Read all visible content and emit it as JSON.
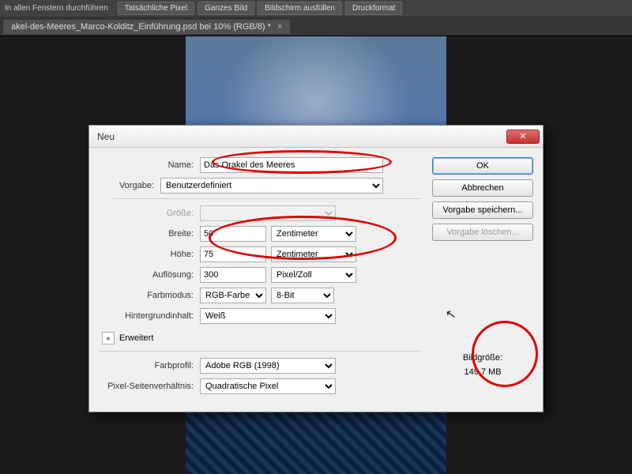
{
  "toolbar": {
    "label": "In allen Fenstern durchführen",
    "buttons": [
      "Tatsächliche Pixel",
      "Ganzes Bild",
      "Bildschirm ausfüllen",
      "Druckformat"
    ]
  },
  "doc_tab": {
    "title": "akel-des-Meeres_Marco-Kolditz_Einführung.psd bei 10% (RGB/8) *",
    "close": "×"
  },
  "dialog": {
    "title": "Neu",
    "labels": {
      "name": "Name:",
      "vorgabe": "Vorgabe:",
      "groesse": "Größe:",
      "breite": "Breite:",
      "hoehe": "Höhe:",
      "aufloesung": "Auflösung:",
      "farbmodus": "Farbmodus:",
      "hintergrund": "Hintergrundinhalt:",
      "erweitert": "Erweitert",
      "farbprofil": "Farbprofil:",
      "pixelseitenv": "Pixel-Seitenverhältnis:"
    },
    "values": {
      "name": "Das Orakel des Meeres",
      "vorgabe": "Benutzerdefiniert",
      "groesse": "",
      "breite": "50",
      "breite_unit": "Zentimeter",
      "hoehe": "75",
      "hoehe_unit": "Zentimeter",
      "aufloesung": "300",
      "aufloesung_unit": "Pixel/Zoll",
      "farbmodus": "RGB-Farbe",
      "bit": "8-Bit",
      "hintergrund": "Weiß",
      "farbprofil": "Adobe RGB (1998)",
      "pixelseitenv": "Quadratische Pixel"
    },
    "buttons": {
      "ok": "OK",
      "abbrechen": "Abbrechen",
      "vorgabe_speichern": "Vorgabe speichern...",
      "vorgabe_loeschen": "Vorgabe löschen..."
    },
    "imagesize": {
      "label": "Bildgröße:",
      "value": "149,7 MB"
    },
    "chevron": "«"
  }
}
